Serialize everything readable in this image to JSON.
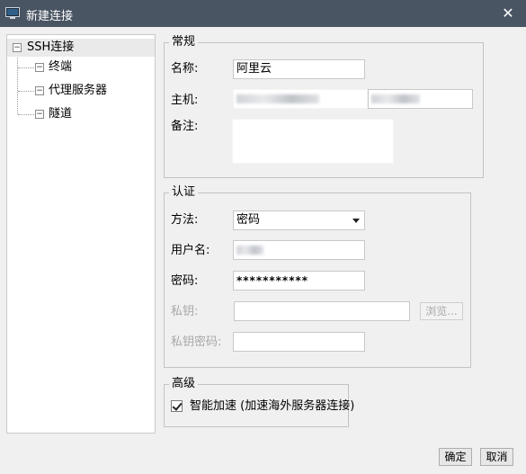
{
  "window": {
    "title": "新建连接",
    "close_glyph": "✕"
  },
  "tree": {
    "root": {
      "label": "SSH连接",
      "toggle": "⊟"
    },
    "children": [
      {
        "label": "终端",
        "toggle": "⊟"
      },
      {
        "label": "代理服务器",
        "toggle": "⊟"
      },
      {
        "label": "隧道",
        "toggle": "⊟"
      }
    ]
  },
  "general": {
    "title": "常规",
    "name_label": "名称:",
    "name_value": "阿里云",
    "host_label": "主机:",
    "note_label": "备注:"
  },
  "auth": {
    "title": "认证",
    "method_label": "方法:",
    "method_value": "密码",
    "username_label": "用户名:",
    "password_label": "密码:",
    "password_value": "***********",
    "key_label": "私钥:",
    "browse_label": "浏览...",
    "key_password_label": "私钥密码:"
  },
  "advanced": {
    "title": "高级",
    "smart_accel_label": "智能加速 (加速海外服务器连接)",
    "smart_accel_checked": true
  },
  "footer": {
    "ok_label": "确定",
    "cancel_label": "取消"
  }
}
